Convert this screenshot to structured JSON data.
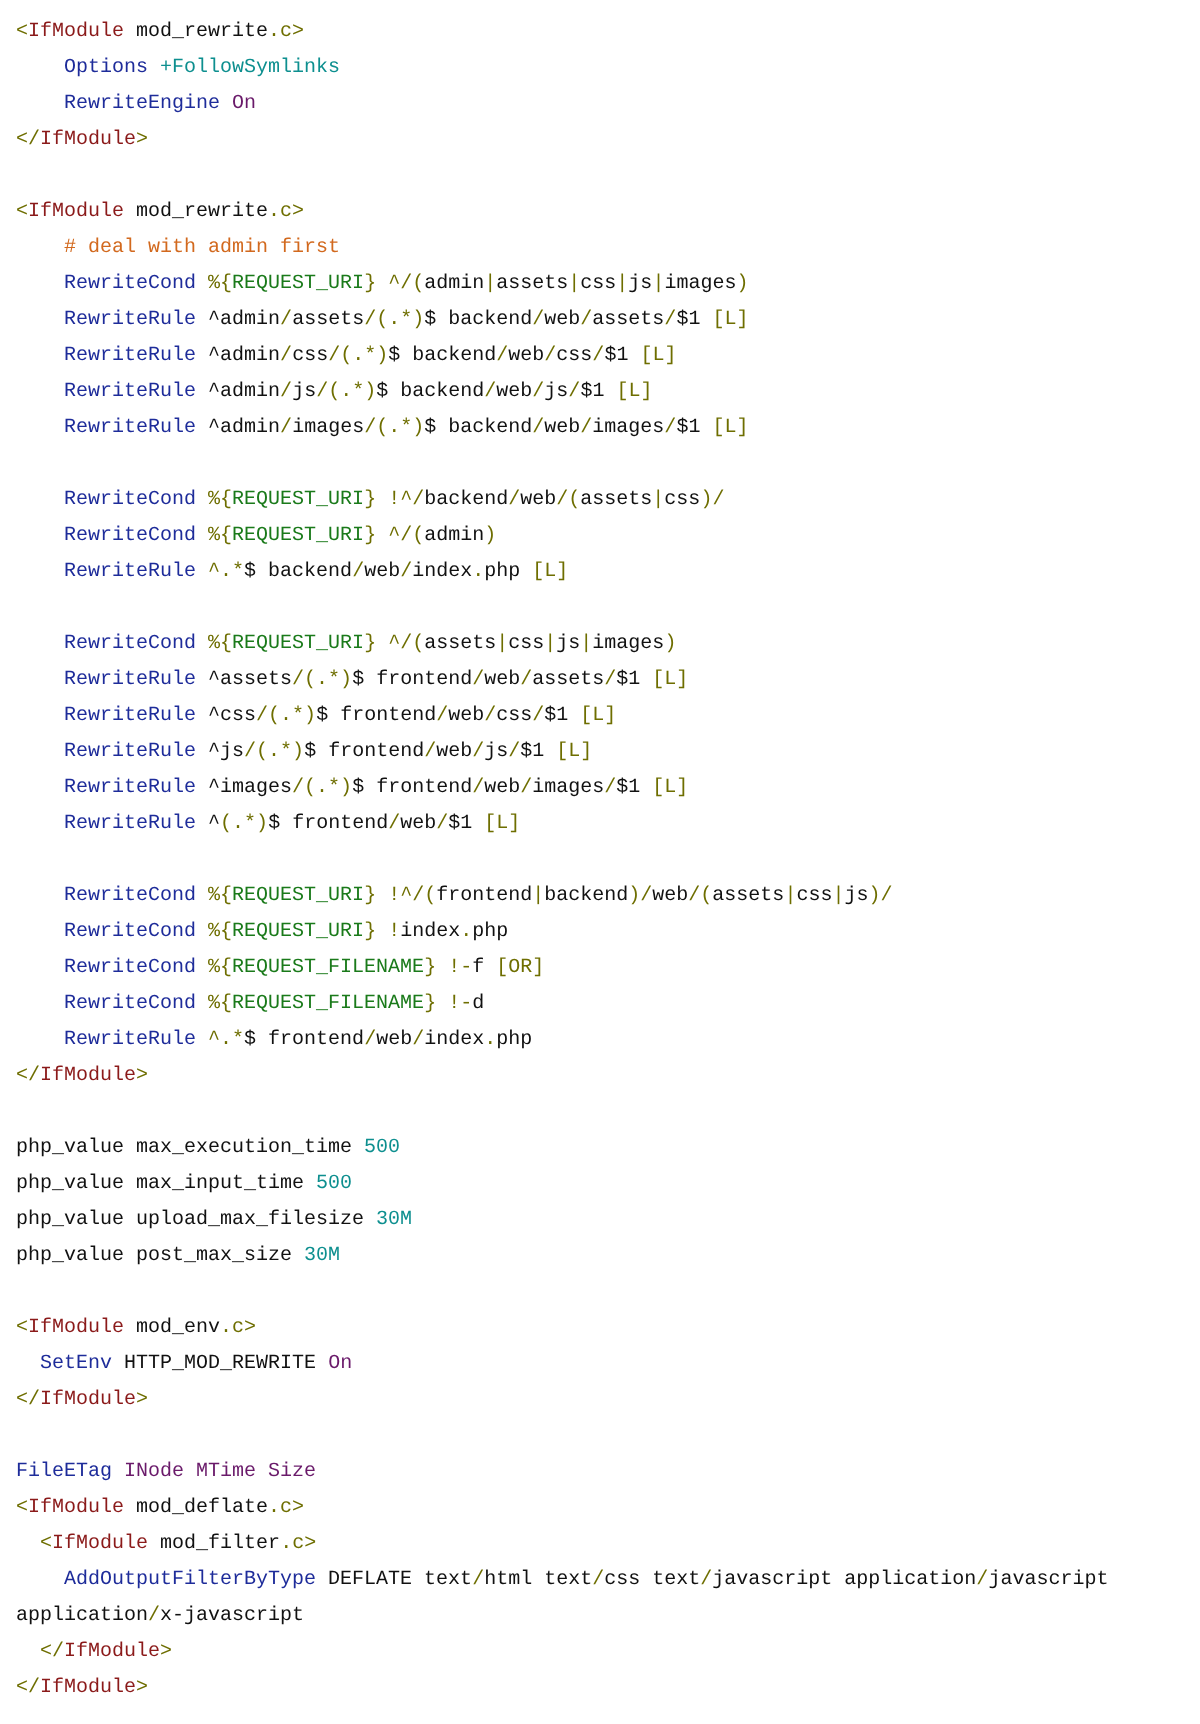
{
  "code_blocks": [
    {
      "lines": [
        {
          "tokens": [
            {
              "kind": "punct",
              "text": "<"
            },
            {
              "kind": "tag",
              "text": "IfModule"
            },
            {
              "kind": "plain",
              "text": " mod_rewrite"
            },
            {
              "kind": "punct",
              "text": ".c>"
            }
          ]
        },
        {
          "tokens": [
            {
              "kind": "directive",
              "text": "    Options"
            },
            {
              "kind": "value",
              "text": " +FollowSymlinks"
            }
          ]
        },
        {
          "tokens": [
            {
              "kind": "directive",
              "text": "    RewriteEngine"
            },
            {
              "kind": "constant",
              "text": " On"
            }
          ]
        },
        {
          "tokens": [
            {
              "kind": "punct",
              "text": "</"
            },
            {
              "kind": "tag",
              "text": "IfModule"
            },
            {
              "kind": "punct",
              "text": ">"
            }
          ]
        }
      ]
    },
    {
      "lines": [
        {
          "tokens": [
            {
              "kind": "punct",
              "text": "<"
            },
            {
              "kind": "tag",
              "text": "IfModule"
            },
            {
              "kind": "plain",
              "text": " mod_rewrite"
            },
            {
              "kind": "punct",
              "text": ".c>"
            }
          ]
        },
        {
          "tokens": [
            {
              "kind": "comment",
              "text": "    # deal with admin first"
            }
          ]
        },
        {
          "tokens": [
            {
              "kind": "directive",
              "text": "    RewriteCond"
            },
            {
              "kind": "punct",
              "text": " %{"
            },
            {
              "kind": "variable",
              "text": "REQUEST_URI"
            },
            {
              "kind": "punct",
              "text": "} ^/("
            },
            {
              "kind": "plain",
              "text": "admin"
            },
            {
              "kind": "punct",
              "text": "|"
            },
            {
              "kind": "plain",
              "text": "assets"
            },
            {
              "kind": "punct",
              "text": "|"
            },
            {
              "kind": "plain",
              "text": "css"
            },
            {
              "kind": "punct",
              "text": "|"
            },
            {
              "kind": "plain",
              "text": "js"
            },
            {
              "kind": "punct",
              "text": "|"
            },
            {
              "kind": "plain",
              "text": "images"
            },
            {
              "kind": "punct",
              "text": ")"
            }
          ]
        },
        {
          "tokens": [
            {
              "kind": "directive",
              "text": "    RewriteRule"
            },
            {
              "kind": "plain",
              "text": " ^admin"
            },
            {
              "kind": "punct",
              "text": "/"
            },
            {
              "kind": "plain",
              "text": "assets"
            },
            {
              "kind": "punct",
              "text": "/(.*)"
            },
            {
              "kind": "plain",
              "text": "$ backend"
            },
            {
              "kind": "punct",
              "text": "/"
            },
            {
              "kind": "plain",
              "text": "web"
            },
            {
              "kind": "punct",
              "text": "/"
            },
            {
              "kind": "plain",
              "text": "assets"
            },
            {
              "kind": "punct",
              "text": "/"
            },
            {
              "kind": "plain",
              "text": "$1 "
            },
            {
              "kind": "punct",
              "text": "[L]"
            }
          ]
        },
        {
          "tokens": [
            {
              "kind": "directive",
              "text": "    RewriteRule"
            },
            {
              "kind": "plain",
              "text": " ^admin"
            },
            {
              "kind": "punct",
              "text": "/"
            },
            {
              "kind": "plain",
              "text": "css"
            },
            {
              "kind": "punct",
              "text": "/(.*)"
            },
            {
              "kind": "plain",
              "text": "$ backend"
            },
            {
              "kind": "punct",
              "text": "/"
            },
            {
              "kind": "plain",
              "text": "web"
            },
            {
              "kind": "punct",
              "text": "/"
            },
            {
              "kind": "plain",
              "text": "css"
            },
            {
              "kind": "punct",
              "text": "/"
            },
            {
              "kind": "plain",
              "text": "$1 "
            },
            {
              "kind": "punct",
              "text": "[L]"
            }
          ]
        },
        {
          "tokens": [
            {
              "kind": "directive",
              "text": "    RewriteRule"
            },
            {
              "kind": "plain",
              "text": " ^admin"
            },
            {
              "kind": "punct",
              "text": "/"
            },
            {
              "kind": "plain",
              "text": "js"
            },
            {
              "kind": "punct",
              "text": "/(.*)"
            },
            {
              "kind": "plain",
              "text": "$ backend"
            },
            {
              "kind": "punct",
              "text": "/"
            },
            {
              "kind": "plain",
              "text": "web"
            },
            {
              "kind": "punct",
              "text": "/"
            },
            {
              "kind": "plain",
              "text": "js"
            },
            {
              "kind": "punct",
              "text": "/"
            },
            {
              "kind": "plain",
              "text": "$1 "
            },
            {
              "kind": "punct",
              "text": "[L]"
            }
          ]
        },
        {
          "tokens": [
            {
              "kind": "directive",
              "text": "    RewriteRule"
            },
            {
              "kind": "plain",
              "text": " ^admin"
            },
            {
              "kind": "punct",
              "text": "/"
            },
            {
              "kind": "plain",
              "text": "images"
            },
            {
              "kind": "punct",
              "text": "/(.*)"
            },
            {
              "kind": "plain",
              "text": "$ backend"
            },
            {
              "kind": "punct",
              "text": "/"
            },
            {
              "kind": "plain",
              "text": "web"
            },
            {
              "kind": "punct",
              "text": "/"
            },
            {
              "kind": "plain",
              "text": "images"
            },
            {
              "kind": "punct",
              "text": "/"
            },
            {
              "kind": "plain",
              "text": "$1 "
            },
            {
              "kind": "punct",
              "text": "[L]"
            }
          ]
        }
      ]
    },
    {
      "lines": [
        {
          "tokens": [
            {
              "kind": "directive",
              "text": "    RewriteCond"
            },
            {
              "kind": "punct",
              "text": " %{"
            },
            {
              "kind": "variable",
              "text": "REQUEST_URI"
            },
            {
              "kind": "punct",
              "text": "} !^/"
            },
            {
              "kind": "plain",
              "text": "backend"
            },
            {
              "kind": "punct",
              "text": "/"
            },
            {
              "kind": "plain",
              "text": "web"
            },
            {
              "kind": "punct",
              "text": "/("
            },
            {
              "kind": "plain",
              "text": "assets"
            },
            {
              "kind": "punct",
              "text": "|"
            },
            {
              "kind": "plain",
              "text": "css"
            },
            {
              "kind": "punct",
              "text": ")/"
            }
          ]
        },
        {
          "tokens": [
            {
              "kind": "directive",
              "text": "    RewriteCond"
            },
            {
              "kind": "punct",
              "text": " %{"
            },
            {
              "kind": "variable",
              "text": "REQUEST_URI"
            },
            {
              "kind": "punct",
              "text": "} ^/("
            },
            {
              "kind": "plain",
              "text": "admin"
            },
            {
              "kind": "punct",
              "text": ")"
            }
          ]
        },
        {
          "tokens": [
            {
              "kind": "directive",
              "text": "    RewriteRule"
            },
            {
              "kind": "punct",
              "text": " ^.*"
            },
            {
              "kind": "plain",
              "text": "$ backend"
            },
            {
              "kind": "punct",
              "text": "/"
            },
            {
              "kind": "plain",
              "text": "web"
            },
            {
              "kind": "punct",
              "text": "/"
            },
            {
              "kind": "plain",
              "text": "index"
            },
            {
              "kind": "punct",
              "text": "."
            },
            {
              "kind": "plain",
              "text": "php "
            },
            {
              "kind": "punct",
              "text": "[L]"
            }
          ]
        }
      ]
    },
    {
      "lines": [
        {
          "tokens": [
            {
              "kind": "directive",
              "text": "    RewriteCond"
            },
            {
              "kind": "punct",
              "text": " %{"
            },
            {
              "kind": "variable",
              "text": "REQUEST_URI"
            },
            {
              "kind": "punct",
              "text": "} ^/("
            },
            {
              "kind": "plain",
              "text": "assets"
            },
            {
              "kind": "punct",
              "text": "|"
            },
            {
              "kind": "plain",
              "text": "css"
            },
            {
              "kind": "punct",
              "text": "|"
            },
            {
              "kind": "plain",
              "text": "js"
            },
            {
              "kind": "punct",
              "text": "|"
            },
            {
              "kind": "plain",
              "text": "images"
            },
            {
              "kind": "punct",
              "text": ")"
            }
          ]
        },
        {
          "tokens": [
            {
              "kind": "directive",
              "text": "    RewriteRule"
            },
            {
              "kind": "plain",
              "text": " ^assets"
            },
            {
              "kind": "punct",
              "text": "/(.*)"
            },
            {
              "kind": "plain",
              "text": "$ frontend"
            },
            {
              "kind": "punct",
              "text": "/"
            },
            {
              "kind": "plain",
              "text": "web"
            },
            {
              "kind": "punct",
              "text": "/"
            },
            {
              "kind": "plain",
              "text": "assets"
            },
            {
              "kind": "punct",
              "text": "/"
            },
            {
              "kind": "plain",
              "text": "$1 "
            },
            {
              "kind": "punct",
              "text": "[L]"
            }
          ]
        },
        {
          "tokens": [
            {
              "kind": "directive",
              "text": "    RewriteRule"
            },
            {
              "kind": "plain",
              "text": " ^css"
            },
            {
              "kind": "punct",
              "text": "/(.*)"
            },
            {
              "kind": "plain",
              "text": "$ frontend"
            },
            {
              "kind": "punct",
              "text": "/"
            },
            {
              "kind": "plain",
              "text": "web"
            },
            {
              "kind": "punct",
              "text": "/"
            },
            {
              "kind": "plain",
              "text": "css"
            },
            {
              "kind": "punct",
              "text": "/"
            },
            {
              "kind": "plain",
              "text": "$1 "
            },
            {
              "kind": "punct",
              "text": "[L]"
            }
          ]
        },
        {
          "tokens": [
            {
              "kind": "directive",
              "text": "    RewriteRule"
            },
            {
              "kind": "plain",
              "text": " ^js"
            },
            {
              "kind": "punct",
              "text": "/(.*)"
            },
            {
              "kind": "plain",
              "text": "$ frontend"
            },
            {
              "kind": "punct",
              "text": "/"
            },
            {
              "kind": "plain",
              "text": "web"
            },
            {
              "kind": "punct",
              "text": "/"
            },
            {
              "kind": "plain",
              "text": "js"
            },
            {
              "kind": "punct",
              "text": "/"
            },
            {
              "kind": "plain",
              "text": "$1 "
            },
            {
              "kind": "punct",
              "text": "[L]"
            }
          ]
        },
        {
          "tokens": [
            {
              "kind": "directive",
              "text": "    RewriteRule"
            },
            {
              "kind": "plain",
              "text": " ^images"
            },
            {
              "kind": "punct",
              "text": "/(.*)"
            },
            {
              "kind": "plain",
              "text": "$ frontend"
            },
            {
              "kind": "punct",
              "text": "/"
            },
            {
              "kind": "plain",
              "text": "web"
            },
            {
              "kind": "punct",
              "text": "/"
            },
            {
              "kind": "plain",
              "text": "images"
            },
            {
              "kind": "punct",
              "text": "/"
            },
            {
              "kind": "plain",
              "text": "$1 "
            },
            {
              "kind": "punct",
              "text": "[L]"
            }
          ]
        },
        {
          "tokens": [
            {
              "kind": "directive",
              "text": "    RewriteRule"
            },
            {
              "kind": "plain",
              "text": " ^"
            },
            {
              "kind": "punct",
              "text": "(.*)"
            },
            {
              "kind": "plain",
              "text": "$ frontend"
            },
            {
              "kind": "punct",
              "text": "/"
            },
            {
              "kind": "plain",
              "text": "web"
            },
            {
              "kind": "punct",
              "text": "/"
            },
            {
              "kind": "plain",
              "text": "$1 "
            },
            {
              "kind": "punct",
              "text": "[L]"
            }
          ]
        }
      ]
    },
    {
      "lines": [
        {
          "tokens": [
            {
              "kind": "directive",
              "text": "    RewriteCond"
            },
            {
              "kind": "punct",
              "text": " %{"
            },
            {
              "kind": "variable",
              "text": "REQUEST_URI"
            },
            {
              "kind": "punct",
              "text": "} !^/("
            },
            {
              "kind": "plain",
              "text": "frontend"
            },
            {
              "kind": "punct",
              "text": "|"
            },
            {
              "kind": "plain",
              "text": "backend"
            },
            {
              "kind": "punct",
              "text": ")/"
            },
            {
              "kind": "plain",
              "text": "web"
            },
            {
              "kind": "punct",
              "text": "/("
            },
            {
              "kind": "plain",
              "text": "assets"
            },
            {
              "kind": "punct",
              "text": "|"
            },
            {
              "kind": "plain",
              "text": "css"
            },
            {
              "kind": "punct",
              "text": "|"
            },
            {
              "kind": "plain",
              "text": "js"
            },
            {
              "kind": "punct",
              "text": ")/"
            }
          ]
        },
        {
          "tokens": [
            {
              "kind": "directive",
              "text": "    RewriteCond"
            },
            {
              "kind": "punct",
              "text": " %{"
            },
            {
              "kind": "variable",
              "text": "REQUEST_URI"
            },
            {
              "kind": "punct",
              "text": "} !"
            },
            {
              "kind": "plain",
              "text": "index"
            },
            {
              "kind": "punct",
              "text": "."
            },
            {
              "kind": "plain",
              "text": "php"
            }
          ]
        },
        {
          "tokens": [
            {
              "kind": "directive",
              "text": "    RewriteCond"
            },
            {
              "kind": "punct",
              "text": " %{"
            },
            {
              "kind": "variable",
              "text": "REQUEST_FILENAME"
            },
            {
              "kind": "punct",
              "text": "} !-"
            },
            {
              "kind": "plain",
              "text": "f "
            },
            {
              "kind": "punct",
              "text": "[OR]"
            }
          ]
        },
        {
          "tokens": [
            {
              "kind": "directive",
              "text": "    RewriteCond"
            },
            {
              "kind": "punct",
              "text": " %{"
            },
            {
              "kind": "variable",
              "text": "REQUEST_FILENAME"
            },
            {
              "kind": "punct",
              "text": "} !-"
            },
            {
              "kind": "plain",
              "text": "d"
            }
          ]
        },
        {
          "tokens": [
            {
              "kind": "directive",
              "text": "    RewriteRule"
            },
            {
              "kind": "punct",
              "text": " ^.*"
            },
            {
              "kind": "plain",
              "text": "$ frontend"
            },
            {
              "kind": "punct",
              "text": "/"
            },
            {
              "kind": "plain",
              "text": "web"
            },
            {
              "kind": "punct",
              "text": "/"
            },
            {
              "kind": "plain",
              "text": "index"
            },
            {
              "kind": "punct",
              "text": "."
            },
            {
              "kind": "plain",
              "text": "php"
            }
          ]
        },
        {
          "tokens": [
            {
              "kind": "punct",
              "text": "</"
            },
            {
              "kind": "tag",
              "text": "IfModule"
            },
            {
              "kind": "punct",
              "text": ">"
            }
          ]
        }
      ]
    },
    {
      "lines": [
        {
          "tokens": [
            {
              "kind": "plain",
              "text": "php_value max_execution_time"
            },
            {
              "kind": "value",
              "text": " 500"
            }
          ]
        },
        {
          "tokens": [
            {
              "kind": "plain",
              "text": "php_value max_input_time"
            },
            {
              "kind": "value",
              "text": " 500"
            }
          ]
        },
        {
          "tokens": [
            {
              "kind": "plain",
              "text": "php_value upload_max_filesize"
            },
            {
              "kind": "value",
              "text": " 30M"
            }
          ]
        },
        {
          "tokens": [
            {
              "kind": "plain",
              "text": "php_value post_max_size"
            },
            {
              "kind": "value",
              "text": " 30M"
            }
          ]
        }
      ]
    },
    {
      "lines": [
        {
          "tokens": [
            {
              "kind": "punct",
              "text": "<"
            },
            {
              "kind": "tag",
              "text": "IfModule"
            },
            {
              "kind": "plain",
              "text": " mod_env"
            },
            {
              "kind": "punct",
              "text": ".c>"
            }
          ]
        },
        {
          "tokens": [
            {
              "kind": "directive",
              "text": "  SetEnv"
            },
            {
              "kind": "plain",
              "text": " HTTP_MOD_REWRITE"
            },
            {
              "kind": "constant",
              "text": " On"
            }
          ]
        },
        {
          "tokens": [
            {
              "kind": "punct",
              "text": "</"
            },
            {
              "kind": "tag",
              "text": "IfModule"
            },
            {
              "kind": "punct",
              "text": ">"
            }
          ]
        }
      ]
    },
    {
      "lines": [
        {
          "tokens": [
            {
              "kind": "directive",
              "text": "FileETag"
            },
            {
              "kind": "constant",
              "text": " INode MTime Size"
            }
          ]
        },
        {
          "tokens": [
            {
              "kind": "punct",
              "text": "<"
            },
            {
              "kind": "tag",
              "text": "IfModule"
            },
            {
              "kind": "plain",
              "text": " mod_deflate"
            },
            {
              "kind": "punct",
              "text": ".c>"
            }
          ]
        },
        {
          "tokens": [
            {
              "kind": "punct",
              "text": "  <"
            },
            {
              "kind": "tag",
              "text": "IfModule"
            },
            {
              "kind": "plain",
              "text": " mod_filter"
            },
            {
              "kind": "punct",
              "text": ".c>"
            }
          ]
        },
        {
          "tokens": [
            {
              "kind": "directive",
              "text": "    AddOutputFilterByType"
            },
            {
              "kind": "plain",
              "text": " DEFLATE text"
            },
            {
              "kind": "punct",
              "text": "/"
            },
            {
              "kind": "plain",
              "text": "html text"
            },
            {
              "kind": "punct",
              "text": "/"
            },
            {
              "kind": "plain",
              "text": "css text"
            },
            {
              "kind": "punct",
              "text": "/"
            },
            {
              "kind": "plain",
              "text": "javascript application"
            },
            {
              "kind": "punct",
              "text": "/"
            },
            {
              "kind": "plain",
              "text": "javascript application"
            },
            {
              "kind": "punct",
              "text": "/"
            },
            {
              "kind": "plain",
              "text": "x-javascript"
            }
          ]
        },
        {
          "tokens": [
            {
              "kind": "punct",
              "text": "  </"
            },
            {
              "kind": "tag",
              "text": "IfModule"
            },
            {
              "kind": "punct",
              "text": ">"
            }
          ]
        },
        {
          "tokens": [
            {
              "kind": "punct",
              "text": "</"
            },
            {
              "kind": "tag",
              "text": "IfModule"
            },
            {
              "kind": "punct",
              "text": ">"
            }
          ]
        }
      ]
    }
  ]
}
